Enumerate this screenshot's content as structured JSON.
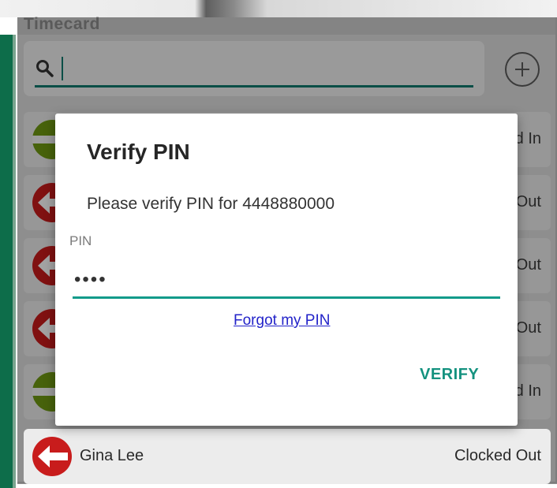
{
  "app": {
    "title": "Timecard"
  },
  "search": {
    "value": "",
    "placeholder": ""
  },
  "employees": [
    {
      "name": "",
      "status": "d In",
      "state": "in"
    },
    {
      "name": "",
      "status": "Out",
      "state": "out"
    },
    {
      "name": "",
      "status": "Out",
      "state": "out"
    },
    {
      "name": "",
      "status": "Out",
      "state": "out"
    },
    {
      "name": "",
      "status": "d In",
      "state": "in"
    },
    {
      "name": "Gina Lee",
      "status": "Clocked Out",
      "state": "out"
    }
  ],
  "dialog": {
    "title": "Verify PIN",
    "message": "Please verify PIN for 4448880000",
    "pin_label": "PIN",
    "pin_value": "••••",
    "forgot_link": "Forgot my PIN",
    "verify_button": "VERIFY"
  },
  "colors": {
    "accent": "#14927f",
    "link": "#2323c9",
    "clocked_in": "#6f9a12",
    "clocked_out": "#c81c1c",
    "side_strip": "#0d6d4a"
  },
  "icons": {
    "search": "search-icon",
    "add": "plus-circle-icon",
    "clocked_in": "clocked-in-icon",
    "clocked_out": "clocked-out-arrow-icon"
  }
}
